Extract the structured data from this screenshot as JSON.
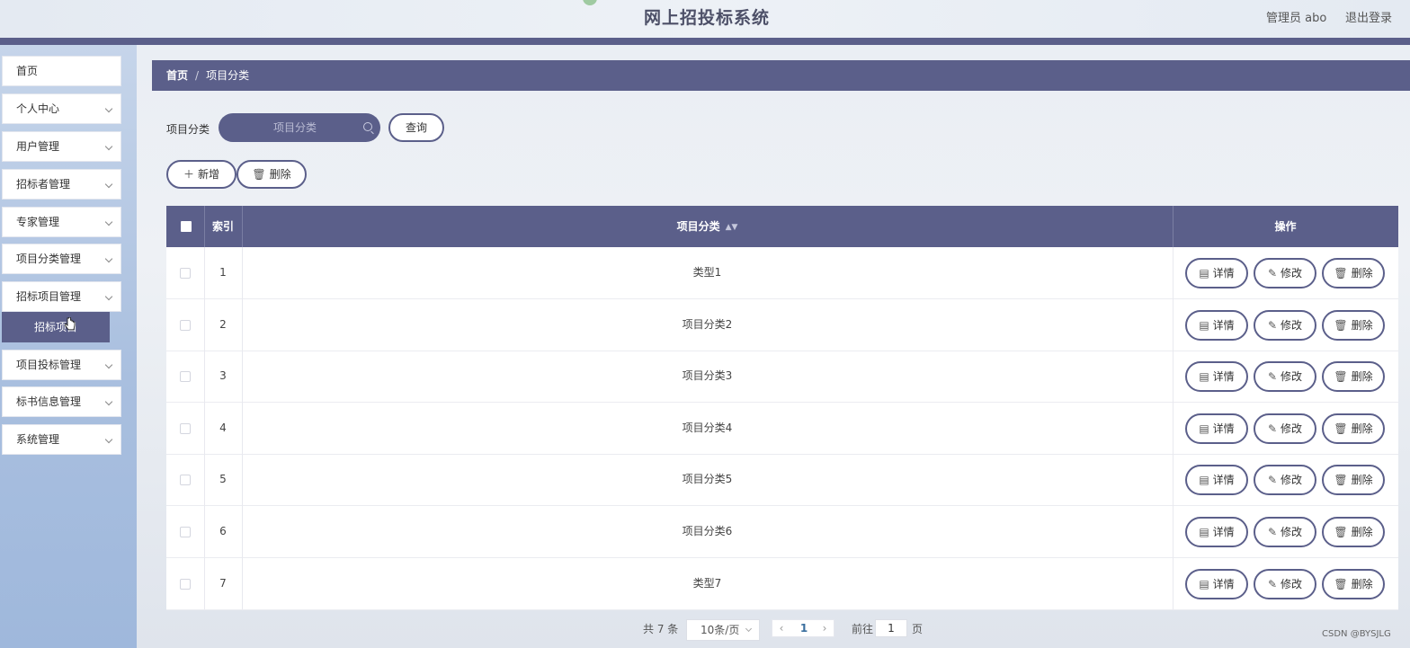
{
  "header": {
    "title": "网上招投标系统",
    "user": "管理员 abo",
    "logout": "退出登录"
  },
  "sidebar": {
    "items": [
      {
        "label": "首页",
        "expandable": false
      },
      {
        "label": "个人中心",
        "expandable": true
      },
      {
        "label": "用户管理",
        "expandable": true
      },
      {
        "label": "招标者管理",
        "expandable": true
      },
      {
        "label": "专家管理",
        "expandable": true
      },
      {
        "label": "项目分类管理",
        "expandable": true
      },
      {
        "label": "招标项目管理",
        "expandable": true,
        "submenu": [
          "招标项目"
        ]
      },
      {
        "label": "项目投标管理",
        "expandable": true
      },
      {
        "label": "标书信息管理",
        "expandable": true
      },
      {
        "label": "系统管理",
        "expandable": true
      }
    ]
  },
  "breadcrumb": {
    "home": "首页",
    "separator": "/",
    "current": "项目分类"
  },
  "search": {
    "label": "项目分类",
    "placeholder": "项目分类",
    "value": "",
    "query_button": "查询"
  },
  "toolbar": {
    "add_label": "新增",
    "delete_label": "删除"
  },
  "table": {
    "columns": [
      "",
      "索引",
      "项目分类",
      "操作"
    ],
    "rows": [
      {
        "index": "1",
        "category": "类型1"
      },
      {
        "index": "2",
        "category": "项目分类2"
      },
      {
        "index": "3",
        "category": "项目分类3"
      },
      {
        "index": "4",
        "category": "项目分类4"
      },
      {
        "index": "5",
        "category": "项目分类5"
      },
      {
        "index": "6",
        "category": "项目分类6"
      },
      {
        "index": "7",
        "category": "类型7"
      }
    ],
    "row_actions": {
      "detail": "详情",
      "edit": "修改",
      "delete": "删除"
    }
  },
  "pagination": {
    "total_text": "共 7 条",
    "page_size": "10条/页",
    "current_page": "1",
    "goto_label": "前往",
    "goto_value": "1",
    "page_unit": "页"
  },
  "watermark": "CSDN @BYSJLG",
  "colors": {
    "primary": "#5b5f8a",
    "sidebar_top": "#c6d5ea",
    "sidebar_bottom": "#9fb8dc",
    "link_blue": "#3a6f9e"
  },
  "icons": {
    "search": "search-icon",
    "add": "plus-icon",
    "delete": "trash-icon",
    "detail": "document-icon",
    "edit": "pencil-icon",
    "expand": "chevron-down-icon"
  }
}
